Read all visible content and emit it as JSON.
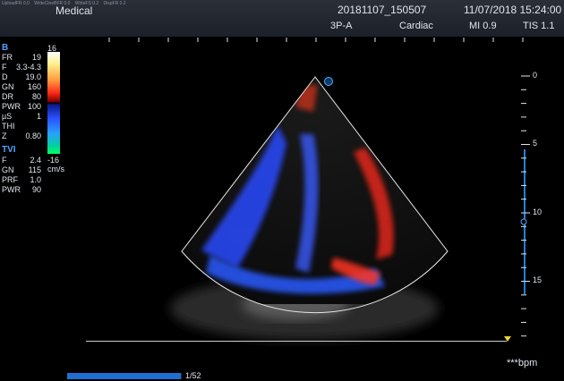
{
  "header": {
    "perf": [
      "UploadFR 0.0",
      "WriteCineBFR 0.0",
      "WriteFS 0.2",
      "DispFR 0.2"
    ],
    "hospital": "Medical",
    "patient_id": "20181107_150507",
    "datetime": "11/07/2018 15:24:00",
    "probe": "3P-A",
    "preset": "Cardiac",
    "mi": "MI 0.9",
    "tis": "TIS 1.1"
  },
  "bmode": {
    "label": "B",
    "params": [
      {
        "key": "FR",
        "value": "19"
      },
      {
        "key": "F",
        "value": "3.3-4.3"
      },
      {
        "key": "D",
        "value": "19.0"
      },
      {
        "key": "GN",
        "value": "160"
      },
      {
        "key": "DR",
        "value": "80"
      },
      {
        "key": "PWR",
        "value": "100"
      },
      {
        "key": "µS",
        "value": "1"
      },
      {
        "key": "THI",
        "value": ""
      },
      {
        "key": "Z",
        "value": "0.80"
      }
    ]
  },
  "colorbar": {
    "max": "16",
    "min": "-16",
    "unit": "cm/s"
  },
  "tvi": {
    "label": "TVI",
    "params": [
      {
        "key": "F",
        "value": "2.4"
      },
      {
        "key": "GN",
        "value": "115"
      },
      {
        "key": "PRF",
        "value": "1.0"
      },
      {
        "key": "PWR",
        "value": "90"
      }
    ]
  },
  "depth_scale": {
    "labels": [
      "0",
      "5",
      "10",
      "15"
    ]
  },
  "heart_rate": "***bpm",
  "cine": {
    "counter": "1/52",
    "progress": 0.99
  },
  "colors": {
    "accent": "#4fa3ff",
    "flow_red": "#ff2a1a",
    "flow_blue": "#2a50ff",
    "focus_marker": "#e8d23a"
  }
}
